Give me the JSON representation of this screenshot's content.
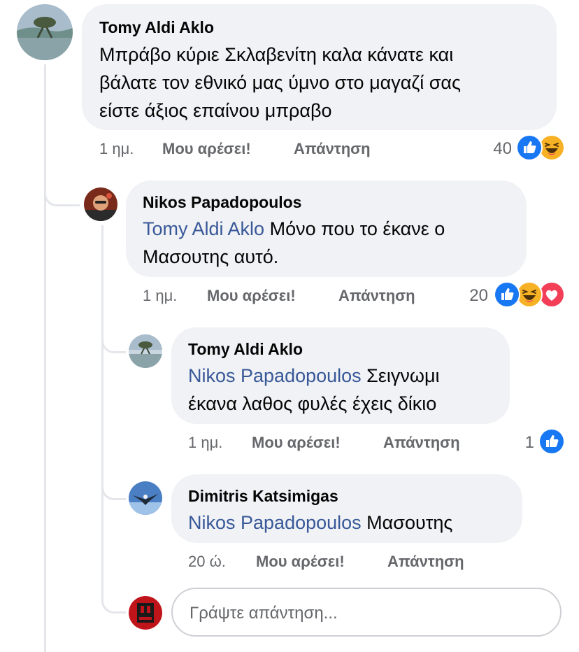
{
  "comments": [
    {
      "author": "Tomy Aldi Aklo",
      "line1": "Μπράβο κύριε Σκλαβενίτη καλα κάνατε και",
      "line2": "βάλατε τον εθνικό μας ύμνο στο μαγαζί σας",
      "line3": "είστε άξιος επαίνου μπραβο",
      "time": "1 ημ.",
      "like": "Μου αρέσει!",
      "reply": "Απάντηση",
      "reaction_count": "40",
      "reactions": [
        "like-icon",
        "haha-icon"
      ]
    },
    {
      "author": "Nikos Papadopoulos",
      "mention": "Tomy Aldi Aklo",
      "line1_rest": " Μόνο που το έκανε ο",
      "line2": "Μασουτης αυτό.",
      "time": "1 ημ.",
      "like": "Μου αρέσει!",
      "reply": "Απάντηση",
      "reaction_count": "20",
      "reactions": [
        "like-icon",
        "haha-icon",
        "love-icon"
      ]
    },
    {
      "author": "Tomy Aldi Aklo",
      "mention": "Nikos Papadopoulos",
      "line1_rest": " Σειγνωμι",
      "line2": "έκανα λαθος φυλές έχεις δίκιο",
      "time": "1 ημ.",
      "like": "Μου αρέσει!",
      "reply": "Απάντηση",
      "reaction_count": "1",
      "reactions": [
        "like-icon"
      ]
    },
    {
      "author": "Dimitris Katsimigas",
      "mention": "Nikos Papadopoulos",
      "line1_rest": " Μασουτης",
      "time": "20 ώ.",
      "like": "Μου αρέσει!",
      "reply": "Απάντηση"
    }
  ],
  "reply_input": {
    "placeholder": "Γράψτε απάντηση..."
  },
  "colors": {
    "bubble": "#f0f2f5",
    "mention": "#385898",
    "meta": "#65676b",
    "like": "#1877f2",
    "haha": "#f7b125",
    "love": "#f33e58"
  }
}
